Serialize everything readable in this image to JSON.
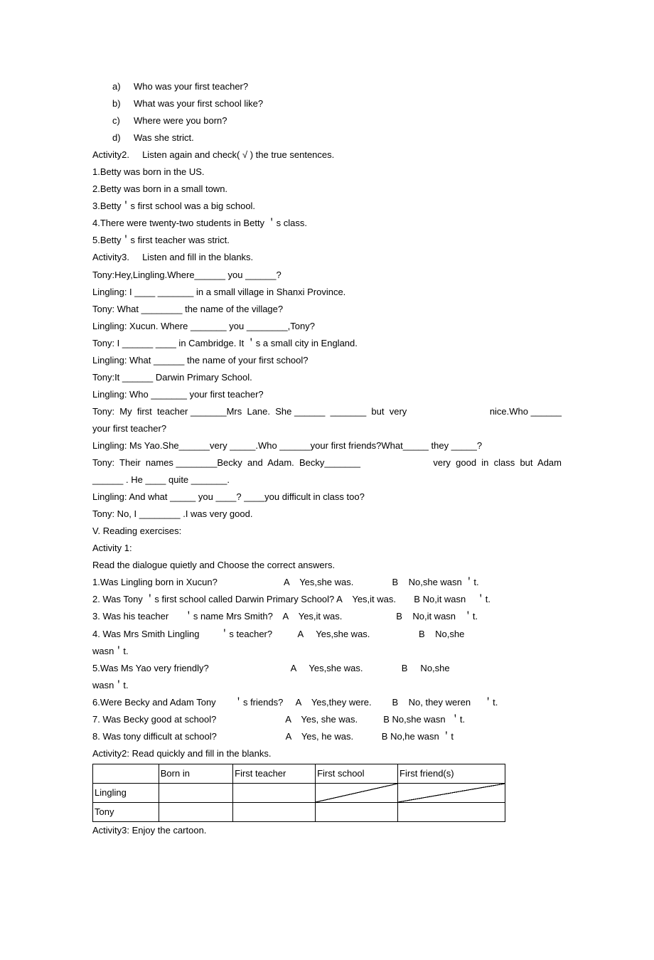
{
  "listA": {
    "letter": "a)",
    "text": "Who was your first teacher?"
  },
  "listB": {
    "letter": "b)",
    "text": "What was your first school like?"
  },
  "listC": {
    "letter": "c)",
    "text": "Where were you born?"
  },
  "listD": {
    "letter": "d)",
    "text": "Was she strict."
  },
  "activity2_title": "Activity2.     Listen again and check( √ ) the true sentences.",
  "a2_1": "1.Betty was born in the US.",
  "a2_2": "2.Betty was born in a small town.",
  "a2_3": "3.Betty＇s first school was a big school.",
  "a2_4": "4.There were twenty-two students in Betty ＇s class.",
  "a2_5": "5.Betty＇s first teacher was strict.",
  "activity3_title": "Activity3.     Listen and fill in the blanks.",
  "d1": "Tony:Hey,Lingling.Where______ you ______?",
  "d2": "Lingling: I ____ _______ in a small village in Shanxi Province.",
  "d3": "Tony: What ________ the name of the village?",
  "d4": "Lingling: Xucun. Where _______ you ________,Tony?",
  "d5": "Tony: I ______ ____ in Cambridge. It ＇s a small city in England.",
  "d6": "Lingling: What ______ the name of your first school?",
  "d7": "Tony:It ______ Darwin Primary School.",
  "d8": "Lingling: Who _______ your first teacher?",
  "d9a": "Tony:  My  first  teacher _______Mrs  Lane.  She ______  _______  but  very",
  "d9b": "nice.Who ______",
  "d10": "your first teacher?",
  "d11": "Lingling: Ms Yao.She______very _____.Who ______your first friends?What_____ they _____?",
  "d12a": "Tony:  Their  names ________Becky  and  Adam.  Becky_______",
  "d12b": "very  good  in  class  but  Adam",
  "d13": "______ . He ____ quite _______.",
  "d14": "Lingling: And what _____ you ____? ____you difficult in class too?",
  "d15": "Tony: No, I ________ .I was very good.",
  "section5": "V. Reading exercises:",
  "act1_title": "Activity 1:",
  "act1_instr": "Read the dialogue quietly and Choose the correct answers.",
  "q1": "1.Was Lingling born in Xucun?                          A    Yes,she was.               B    No,she wasn ＇t.",
  "q2": "2. Was Tony ＇s first school called Darwin Primary School? A    Yes,it was.       B No,it wasn    ＇t.",
  "q3": "3. Was his teacher      ＇s name Mrs Smith?    A    Yes,it was.                     B    No,it wasn   ＇t.",
  "q4": "4. Was Mrs Smith Lingling        ＇s teacher?          A     Yes,she was.                   B    No,she",
  "q4b": "wasn＇t.",
  "q5": "5.Was Ms Yao very friendly?                                A     Yes,she was.               B     No,she",
  "q5b": "wasn＇t.",
  "q6": "6.Were Becky and Adam Tony       ＇s friends?     A    Yes,they were.        B    No, they weren     ＇t.",
  "q7": "7. Was Becky good at school?                           A    Yes, she was.          B No,she wasn  ＇t.",
  "q8": "8. Was tony difficult at school?                           A    Yes, he was.           B No,he wasn ＇t",
  "act2_title": "Activity2: Read quickly and fill in the blanks.",
  "tbl": {
    "h1": "",
    "h2": "Born in",
    "h3": "First teacher",
    "h4": "First school",
    "h5": "First friend(s)",
    "r1": "Lingling",
    "r2": "Tony"
  },
  "act3_title": "Activity3: Enjoy the cartoon."
}
